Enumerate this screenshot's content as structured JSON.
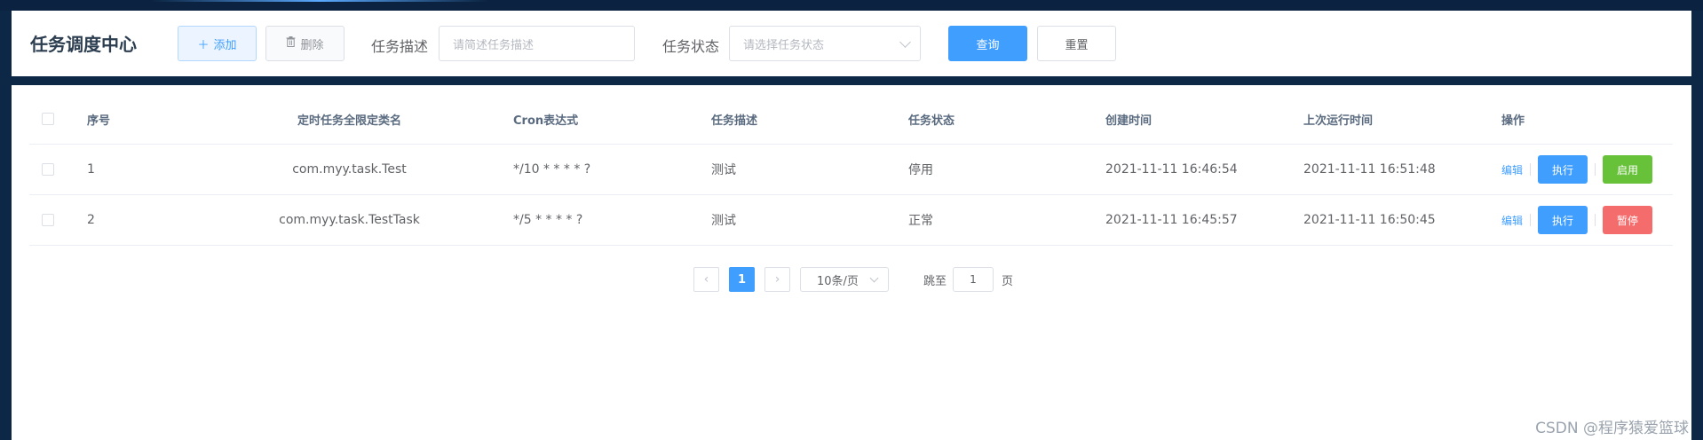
{
  "header": {
    "title": "任务调度中心",
    "add_label": "添加",
    "delete_label": "删除",
    "desc_label": "任务描述",
    "desc_placeholder": "请简述任务描述",
    "status_label": "任务状态",
    "status_placeholder": "请选择任务状态",
    "query_label": "查询",
    "reset_label": "重置"
  },
  "table": {
    "columns": [
      "序号",
      "定时任务全限定类名",
      "Cron表达式",
      "任务描述",
      "任务状态",
      "创建时间",
      "上次运行时间",
      "操作"
    ],
    "rows": [
      {
        "index": "1",
        "class_name": "com.myy.task.Test",
        "cron": "*/10 * * * * ?",
        "desc": "测试",
        "status": "停用",
        "created": "2021-11-11 16:46:54",
        "last_run": "2021-11-11 16:51:48",
        "edit": "编辑",
        "run": "执行",
        "toggle": "启用"
      },
      {
        "index": "2",
        "class_name": "com.myy.task.TestTask",
        "cron": "*/5 * * * * ?",
        "desc": "测试",
        "status": "正常",
        "created": "2021-11-11 16:45:57",
        "last_run": "2021-11-11 16:50:45",
        "edit": "编辑",
        "run": "执行",
        "toggle": "暂停"
      }
    ]
  },
  "pagination": {
    "current_page": "1",
    "page_size": "10条/页",
    "goto_label": "跳至",
    "goto_value": "1",
    "page_suffix": "页"
  },
  "watermark": "CSDN @程序猿爱篮球",
  "colors": {
    "primary": "#409eff",
    "success": "#67c23a",
    "danger": "#f56c6c",
    "background": "#0d2846"
  }
}
